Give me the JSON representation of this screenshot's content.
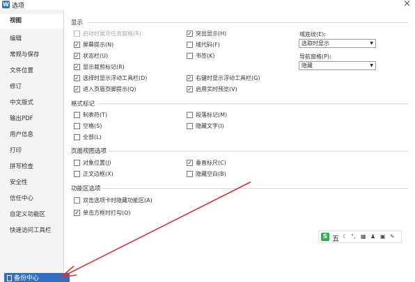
{
  "window": {
    "app_icon": "W",
    "title": "选项",
    "close_icon": "×"
  },
  "sidebar": {
    "items": [
      {
        "label": "视图",
        "selected": true
      },
      {
        "label": "编辑"
      },
      {
        "label": "常规与保存"
      },
      {
        "label": "文件位置"
      },
      {
        "label": "修订"
      },
      {
        "label": "中文版式"
      },
      {
        "label": "输出PDF"
      },
      {
        "label": "用户信息"
      },
      {
        "label": "打印"
      },
      {
        "label": "拼写检查"
      },
      {
        "label": "安全性"
      },
      {
        "label": "信任中心"
      },
      {
        "label": "自定义功能区"
      },
      {
        "label": "快速访问工具栏"
      }
    ],
    "backup_button": "备份中心"
  },
  "sections": {
    "display": {
      "title": "显示",
      "options": [
        {
          "label": "启动时展开任务窗格(R)",
          "checked": false,
          "disabled": true
        },
        {
          "label": "屏幕提示(N)",
          "checked": true
        },
        {
          "label": "状态栏(U)",
          "checked": true
        },
        {
          "label": "显示裁剪标记(R)",
          "checked": true
        },
        {
          "label": "选择时显示浮动工具栏(D)",
          "checked": true
        },
        {
          "label": "进入页眉页脚提示(Q)",
          "checked": true
        },
        {
          "label": "突出显示(H)",
          "checked": true
        },
        {
          "label": "域代码(F)",
          "checked": false
        },
        {
          "label": "书签(K)",
          "checked": false
        },
        {
          "label": "右键时显示浮动工具栏(G)",
          "checked": true
        },
        {
          "label": "启用实时预览(V)",
          "checked": true
        }
      ],
      "field_shading_label": "域底纹(E):",
      "field_shading_value": "选取时显示",
      "nav_pane_label": "导航窗格(P):",
      "nav_pane_value": "隐藏"
    },
    "format_marks": {
      "title": "格式标记",
      "options": [
        {
          "label": "制表符(T)",
          "checked": false
        },
        {
          "label": "空格(S)",
          "checked": false
        },
        {
          "label": "全部(L)",
          "checked": false
        },
        {
          "label": "段落标记(M)",
          "checked": false
        },
        {
          "label": "隐藏文字(I)",
          "checked": false
        }
      ]
    },
    "page_view": {
      "title": "页面视图选项",
      "options": [
        {
          "label": "对象位置(J)",
          "checked": false
        },
        {
          "label": "正文边框(X)",
          "checked": false
        },
        {
          "label": "垂直标尺(C)",
          "checked": true
        },
        {
          "label": "隐藏空白(B)",
          "checked": false
        }
      ]
    },
    "ribbon": {
      "title": "功能区选项",
      "options": [
        {
          "label": "双击选项卡时隐藏功能区(A)",
          "checked": false
        },
        {
          "label": "单击方框时打勾(O)",
          "checked": true
        }
      ]
    }
  },
  "ime_toolbar": {
    "logo": "S",
    "mode": "五",
    "icons": [
      "moon-icon",
      "punctuation-icon",
      "keyboard-icon",
      "user-icon",
      "skin-icon",
      "wrench-icon"
    ]
  },
  "colors": {
    "accent": "#2f6fc6",
    "annotation_arrow": "#d9312b",
    "ime_green": "#2bb24c"
  }
}
